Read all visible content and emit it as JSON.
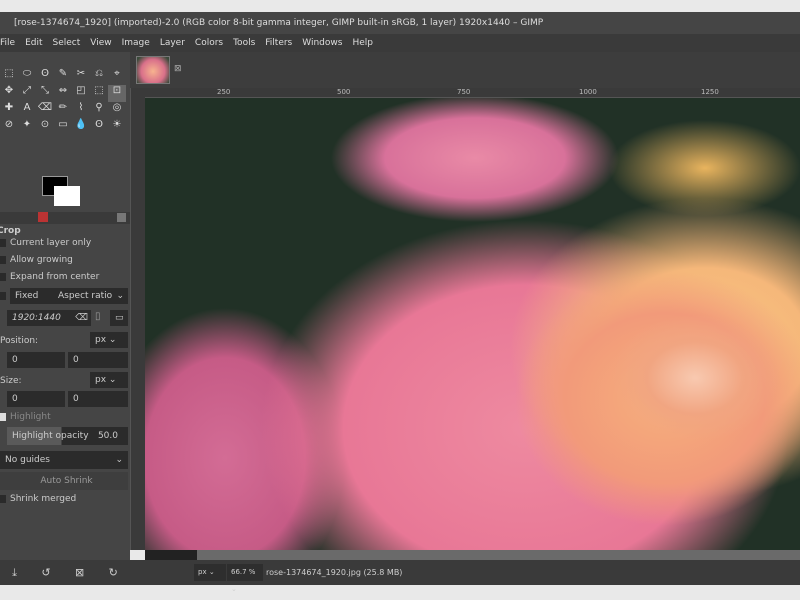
{
  "window": {
    "title": "[rose-1374674_1920] (imported)-2.0 (RGB color 8-bit gamma integer, GIMP built-in sRGB, 1 layer) 1920x1440 – GIMP"
  },
  "menu": [
    "File",
    "Edit",
    "Select",
    "View",
    "Image",
    "Layer",
    "Colors",
    "Tools",
    "Filters",
    "Windows",
    "Help"
  ],
  "toolbox": {
    "icons": [
      "⬚",
      "⬭",
      "ʘ",
      "✎",
      "✂",
      "⎌",
      "⌖",
      "✥",
      "⤢",
      "⤡",
      "⇔",
      "◰",
      "⬚",
      "⊡",
      "✚",
      "A",
      "⌫",
      "✏",
      "⌇",
      "⚲",
      "◎",
      "⊘",
      "✦",
      "⊙",
      "▭",
      "💧",
      "ʘ",
      "☀"
    ]
  },
  "tool_options": {
    "title": "Crop",
    "current_layer_only": "Current layer only",
    "allow_growing": "Allow growing",
    "expand_from_center": "Expand from center",
    "fixed": "Fixed",
    "aspect_mode": "Aspect ratio",
    "ratio": "1920:1440",
    "position_label": "Position:",
    "position_unit": "px",
    "position_x": "0",
    "position_y": "0",
    "size_label": "Size:",
    "size_unit": "px",
    "size_w": "0",
    "size_h": "0",
    "highlight": "Highlight",
    "highlight_opacity_label": "Highlight opacity",
    "highlight_opacity": "50.0",
    "guides": "No guides",
    "auto_shrink": "Auto Shrink",
    "shrink_merged": "Shrink merged"
  },
  "ruler": [
    "250",
    "500",
    "750",
    "1000",
    "1250"
  ],
  "status": {
    "unit": "px",
    "zoom": "66.7 %",
    "file": "rose-1374674_1920.jpg (25.8 MB)"
  }
}
